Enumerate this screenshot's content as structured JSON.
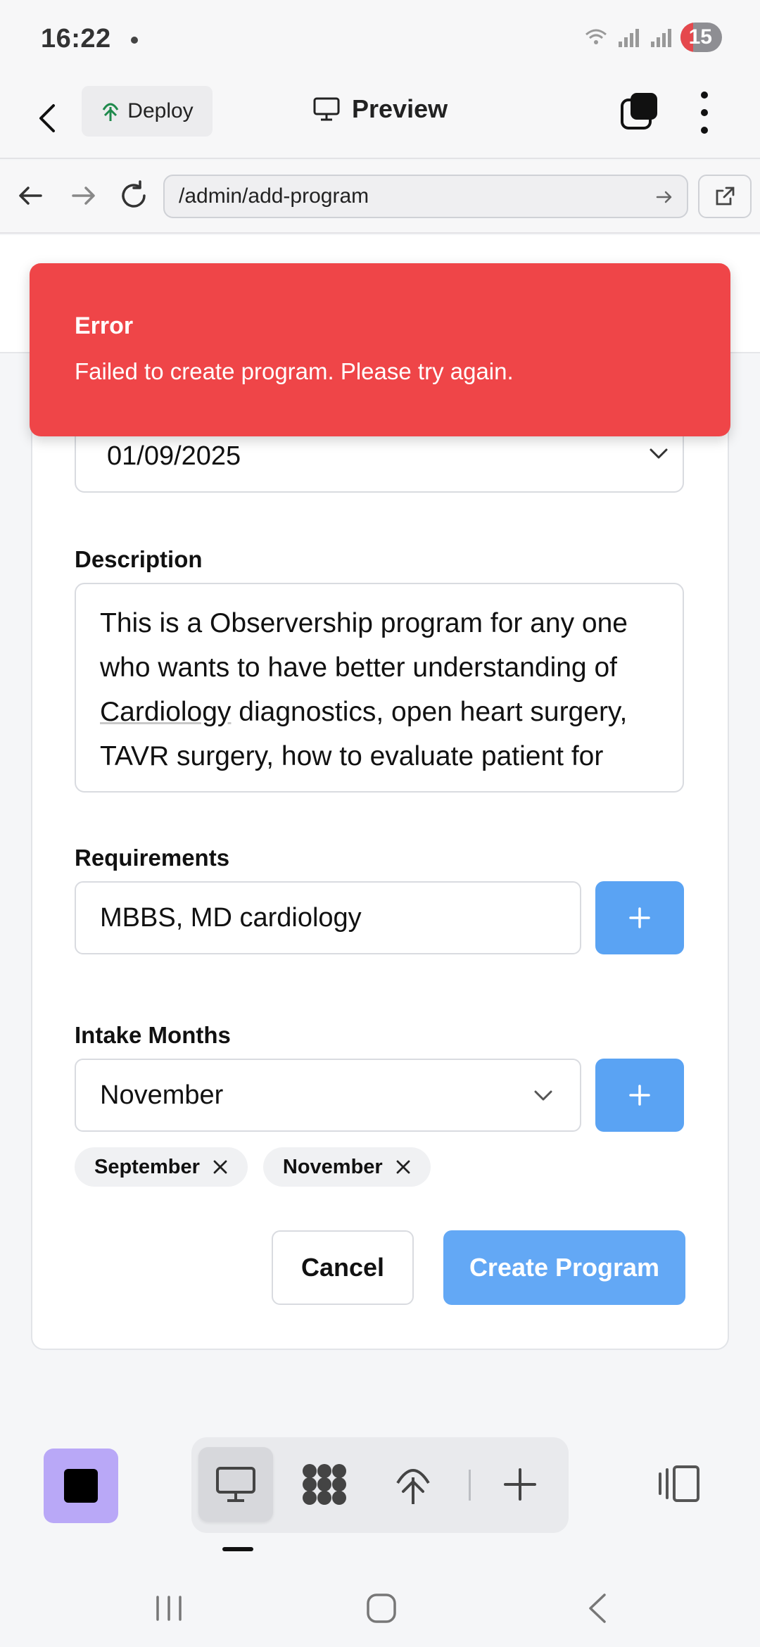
{
  "status_bar": {
    "time": "16:22",
    "battery": "15"
  },
  "header": {
    "deploy_label": "Deploy",
    "preview_label": "Preview"
  },
  "browser": {
    "url": "/admin/add-program"
  },
  "toast": {
    "title": "Error",
    "message": "Failed to create program. Please try again."
  },
  "form": {
    "date_value": "01/09/2025",
    "description_label": "Description",
    "description_text": "This is a Observership program for any one who wants to have better understanding of ",
    "description_underlined": "Cardiology",
    "description_text_after": " diagnostics, open heart surgery, TAVR surgery, how to evaluate patient for surgery",
    "requirements_label": "Requirements",
    "requirements_value": "MBBS, MD cardiology",
    "intake_label": "Intake Months",
    "intake_selected": "November",
    "chips": [
      "September",
      "November"
    ],
    "cancel_label": "Cancel",
    "create_label": "Create Program"
  },
  "colors": {
    "toast_bg": "#ef4548",
    "primary_button": "#63a8f5",
    "square_button": "#b9a8f7"
  },
  "icons": {
    "tools": [
      "monitor-icon",
      "apps-grid-icon",
      "deploy-tree-icon",
      "plus-icon"
    ]
  }
}
